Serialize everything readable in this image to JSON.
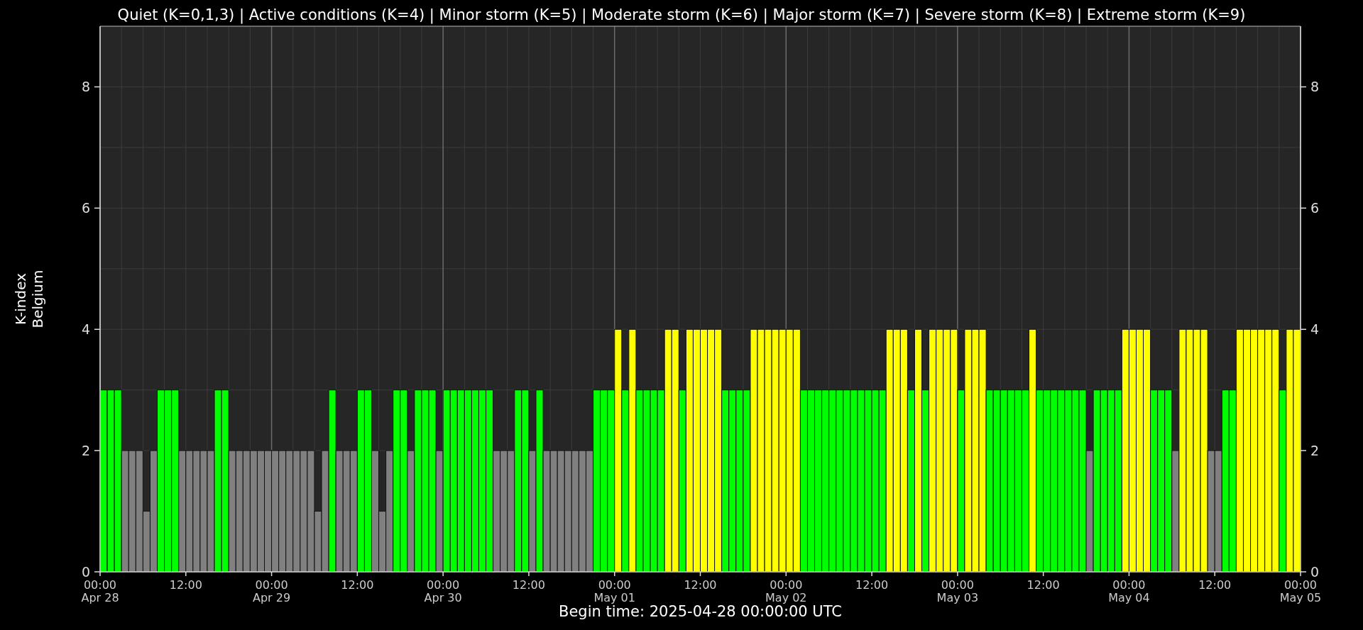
{
  "chart": {
    "chart_data": {
      "type": "bar",
      "title": "Quiet (K=0,1,3) | Active conditions (K=4) | Minor storm (K=5) | Moderate storm (K=6) | Major storm (K=7) | Severe storm (K=8) | Extreme storm (K=9)",
      "xlabel": "Begin time: 2025-04-28 00:00:00 UTC",
      "ylabel": "K-index\nBelgium",
      "categories": [
        "00:00\nApr 28",
        null,
        null,
        null,
        null,
        null,
        null,
        null,
        null,
        null,
        null,
        null,
        "12:00",
        null,
        null,
        null,
        null,
        null,
        null,
        null,
        null,
        null,
        null,
        null,
        "00:00\nApr 29",
        null,
        null,
        null,
        null,
        null,
        null,
        null,
        null,
        null,
        null,
        null,
        "12:00",
        null,
        null,
        null,
        null,
        null,
        null,
        null,
        null,
        null,
        null,
        null,
        "00:00\nApr 30",
        null,
        null,
        null,
        null,
        null,
        null,
        null,
        null,
        null,
        null,
        null,
        "12:00",
        null,
        null,
        null,
        null,
        null,
        null,
        null,
        null,
        null,
        null,
        null,
        "00:00\nMay 01",
        null,
        null,
        null,
        null,
        null,
        null,
        null,
        null,
        null,
        null,
        null,
        "12:00",
        null,
        null,
        null,
        null,
        null,
        null,
        null,
        null,
        null,
        null,
        null,
        "00:00\nMay 02",
        null,
        null,
        null,
        null,
        null,
        null,
        null,
        null,
        null,
        null,
        null,
        "12:00",
        null,
        null,
        null,
        null,
        null,
        null,
        null,
        null,
        null,
        null,
        null,
        "00:00\nMay 03",
        null,
        null,
        null,
        null,
        null,
        null,
        null,
        null,
        null,
        null,
        null,
        "12:00",
        null,
        null,
        null,
        null,
        null,
        null,
        null,
        null,
        null,
        null,
        null,
        "00:00\nMay 04",
        null,
        null,
        null,
        null,
        null,
        null,
        null,
        null,
        null,
        null,
        null,
        "12:00",
        null,
        null,
        null,
        null,
        null,
        null,
        null,
        null,
        null,
        null,
        null
      ],
      "values": [
        3,
        3,
        3,
        2,
        2,
        2,
        1,
        2,
        3,
        3,
        3,
        2,
        2,
        2,
        2,
        2,
        3,
        3,
        2,
        2,
        2,
        2,
        2,
        2,
        2,
        2,
        2,
        2,
        2,
        2,
        1,
        2,
        3,
        2,
        2,
        2,
        3,
        3,
        2,
        1,
        2,
        3,
        3,
        2,
        3,
        3,
        3,
        2,
        3,
        3,
        3,
        3,
        3,
        3,
        3,
        2,
        2,
        2,
        3,
        3,
        2,
        3,
        2,
        2,
        2,
        2,
        2,
        2,
        2,
        3,
        3,
        3,
        4,
        3,
        4,
        3,
        3,
        3,
        3,
        4,
        4,
        3,
        4,
        4,
        4,
        4,
        4,
        3,
        3,
        3,
        3,
        4,
        4,
        4,
        4,
        4,
        4,
        4,
        3,
        3,
        3,
        3,
        3,
        3,
        3,
        3,
        3,
        3,
        3,
        3,
        4,
        4,
        4,
        3,
        4,
        3,
        4,
        4,
        4,
        4,
        3,
        4,
        4,
        4,
        3,
        3,
        3,
        3,
        3,
        3,
        4,
        3,
        3,
        3,
        3,
        3,
        3,
        3,
        2,
        3,
        3,
        3,
        3,
        4,
        4,
        4,
        4,
        3,
        3,
        3,
        2,
        4,
        4,
        4,
        4,
        2,
        2,
        3,
        3,
        4,
        4,
        4,
        4,
        4,
        4,
        3,
        4,
        4
      ],
      "ylim": [
        0,
        9
      ],
      "yticks": [
        0,
        2,
        4,
        6,
        8
      ],
      "grid": true
    },
    "x_end_label": "00:00\nMay 05",
    "right_axis_labels": [
      "8",
      "6",
      "4",
      "2",
      "0"
    ]
  }
}
